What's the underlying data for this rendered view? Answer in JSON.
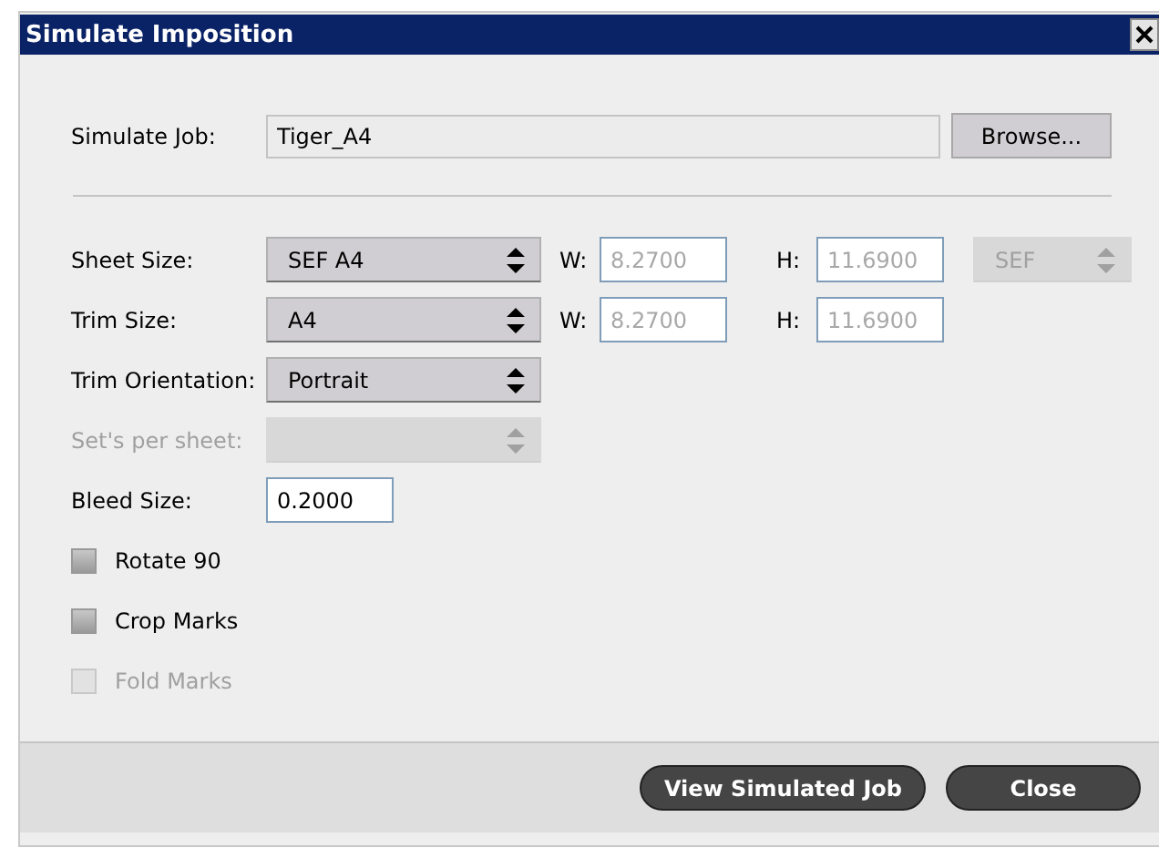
{
  "window": {
    "title": "Simulate Imposition"
  },
  "job": {
    "label": "Simulate Job:",
    "value": "Tiger_A4",
    "button": "Browse..."
  },
  "rows": [
    {
      "label": "Sheet Size:",
      "disabled": false,
      "select": {
        "value": "SEF A4",
        "disabled": false
      },
      "width": {
        "label": "W:",
        "value": "8.2700",
        "disabled": true
      },
      "height": {
        "label": "H:",
        "value": "11.6900",
        "disabled": true
      },
      "orientation": {
        "value": "SEF",
        "disabled": true
      }
    },
    {
      "label": "Trim Size:",
      "disabled": false,
      "select": {
        "value": "A4",
        "disabled": false
      },
      "width": {
        "label": "W:",
        "value": "8.2700",
        "disabled": true
      },
      "height": {
        "label": "H:",
        "value": "11.6900",
        "disabled": true
      }
    },
    {
      "label": "Trim Orientation:",
      "disabled": false,
      "select": {
        "value": "Portrait",
        "disabled": false
      }
    },
    {
      "label": "Set's per sheet:",
      "disabled": true,
      "select": {
        "disabled": true
      }
    }
  ],
  "bleed": {
    "label": "Bleed Size:",
    "value": "0.2000",
    "disabled": false
  },
  "checkboxes": [
    {
      "label": "Rotate 90",
      "checked": false,
      "disabled": false
    },
    {
      "label": "Crop Marks",
      "checked": false,
      "disabled": false
    },
    {
      "label": "Fold Marks",
      "checked": false,
      "disabled": true
    }
  ],
  "buttons": [
    "View Simulated Job",
    "Close"
  ]
}
